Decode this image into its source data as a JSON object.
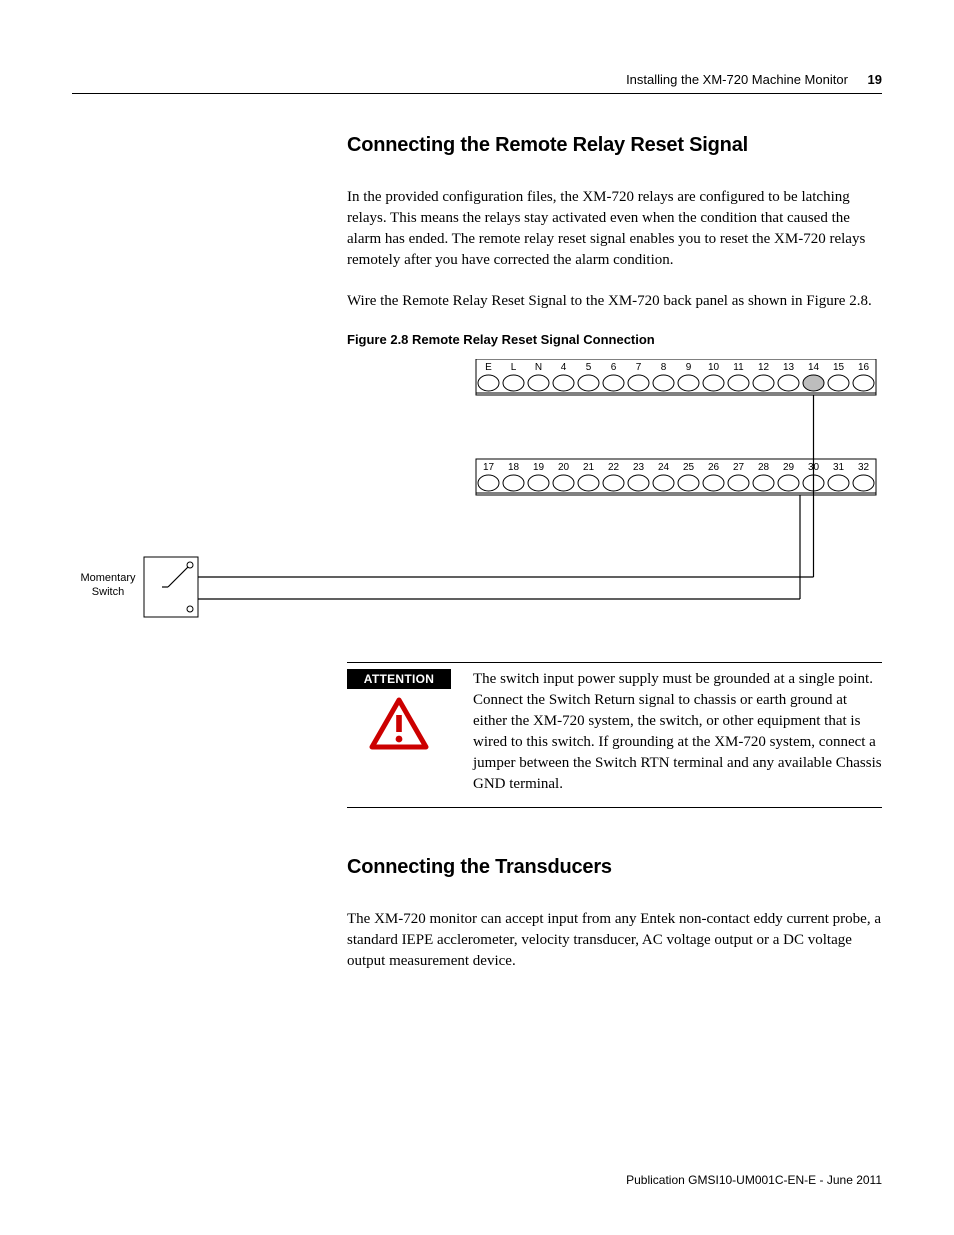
{
  "header": {
    "chapter_title": "Installing the XM-720 Machine Monitor",
    "page_number": "19"
  },
  "section1": {
    "heading": "Connecting the Remote Relay Reset Signal",
    "para1": "In the provided configuration files, the XM-720 relays are configured to be latching relays. This means the relays stay activated even when the condition that caused the alarm has ended. The remote relay reset signal enables you to reset the XM-720 relays remotely after you have corrected the alarm condition.",
    "para2": "Wire the Remote Relay Reset Signal to the XM-720 back panel as shown in Figure 2.8.",
    "figure_caption": "Figure 2.8 Remote Relay Reset Signal Connection"
  },
  "diagram": {
    "switch_label_line1": "Momentary",
    "switch_label_line2": "Switch",
    "row1_labels": [
      "E",
      "L",
      "N",
      "4",
      "5",
      "6",
      "7",
      "8",
      "9",
      "10",
      "11",
      "12",
      "13",
      "14",
      "15",
      "16"
    ],
    "row2_labels": [
      "17",
      "18",
      "19",
      "20",
      "21",
      "22",
      "23",
      "24",
      "25",
      "26",
      "27",
      "28",
      "29",
      "30",
      "31",
      "32"
    ]
  },
  "attention": {
    "label": "ATTENTION",
    "text": "The switch input power supply must be grounded at a single point. Connect the Switch Return signal to chassis or earth ground at either the XM-720 system, the switch, or other equipment that is wired to this switch. If grounding at the XM-720 system, connect a jumper between the Switch RTN terminal and any available Chassis GND terminal."
  },
  "section2": {
    "heading": "Connecting the Transducers",
    "para1": "The XM-720 monitor can accept input from any Entek non-contact eddy current probe, a standard IEPE acclerometer, velocity transducer, AC voltage output or a DC voltage output measurement device."
  },
  "footer": {
    "publication": "Publication GMSI10-UM001C-EN-E - June 2011"
  }
}
